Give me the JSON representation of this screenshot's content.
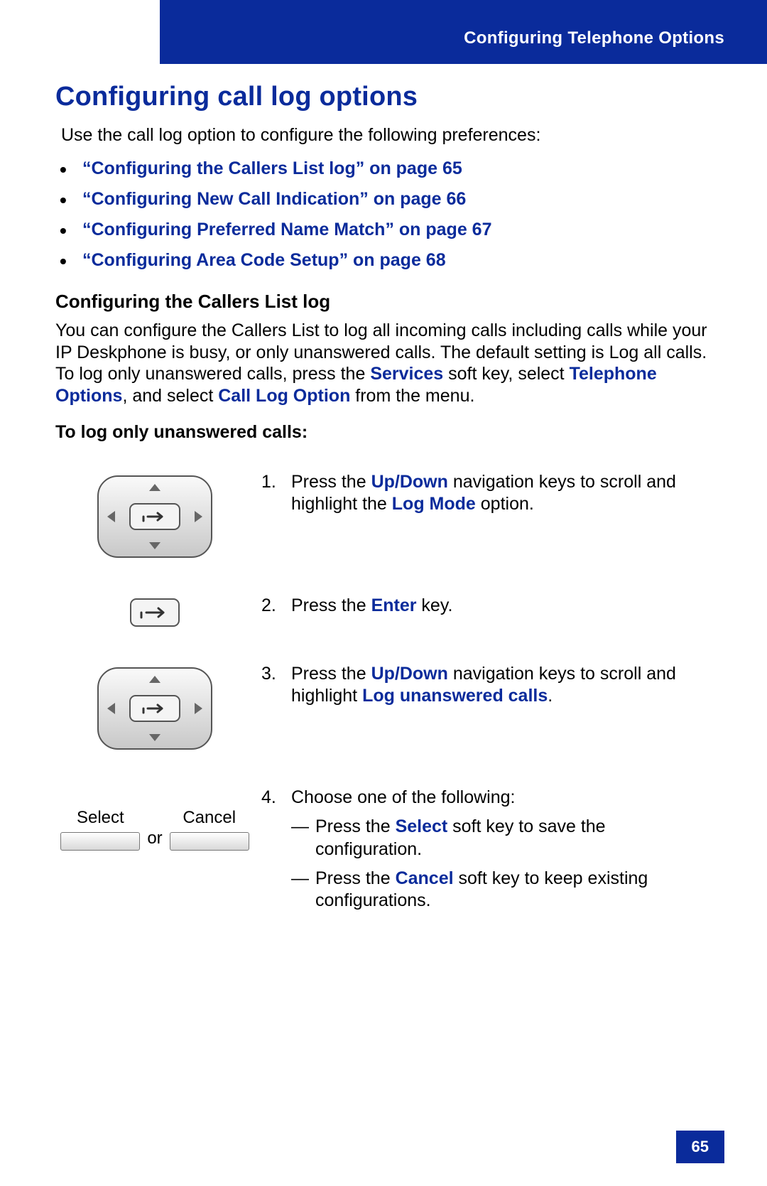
{
  "header": {
    "title": "Configuring Telephone Options"
  },
  "h1": "Configuring call log options",
  "intro": "Use the call log option to configure the following preferences:",
  "toc": [
    "“Configuring the Callers List log” on page 65",
    "“Configuring New Call Indication” on page 66",
    "“Configuring Preferred Name Match” on page 67",
    "“Configuring Area Code Setup” on page 68"
  ],
  "h2": "Configuring the Callers List log",
  "body": {
    "p1a": "You can configure the Callers List to log all incoming calls including calls while your IP Deskphone is busy,  or only unanswered calls. The default setting is Log all calls. To log only unanswered calls, press the ",
    "services": "Services",
    "p1b": " soft key, select ",
    "telopt": "Telephone Options",
    "p1c": ", and select ",
    "clopt": "Call Log Option",
    "p1d": " from the menu."
  },
  "h3": "To log only unanswered calls:",
  "steps": {
    "s1": {
      "num": "1.",
      "a": "Press the ",
      "updown": "Up/Down",
      "b": " navigation keys to scroll and highlight the ",
      "logmode": "Log Mode",
      "c": " option."
    },
    "s2": {
      "num": "2.",
      "a": "Press the ",
      "enter": "Enter",
      "b": " key."
    },
    "s3": {
      "num": "3.",
      "a": "Press the ",
      "updown": "Up/Down",
      "b": " navigation keys to scroll and highlight ",
      "logun": "Log unanswered calls",
      "c": "."
    },
    "s4": {
      "num": "4.",
      "a": "Choose one of the following:",
      "sub1a": "Press the ",
      "select": "Select",
      "sub1b": " soft key to save the configuration.",
      "sub2a": "Press the ",
      "cancel": "Cancel",
      "sub2b": " soft key to keep existing configurations."
    }
  },
  "softkeys": {
    "select": "Select",
    "or": "or",
    "cancel": "Cancel"
  },
  "page_number": "65",
  "glyphs": {
    "dash": "—"
  }
}
